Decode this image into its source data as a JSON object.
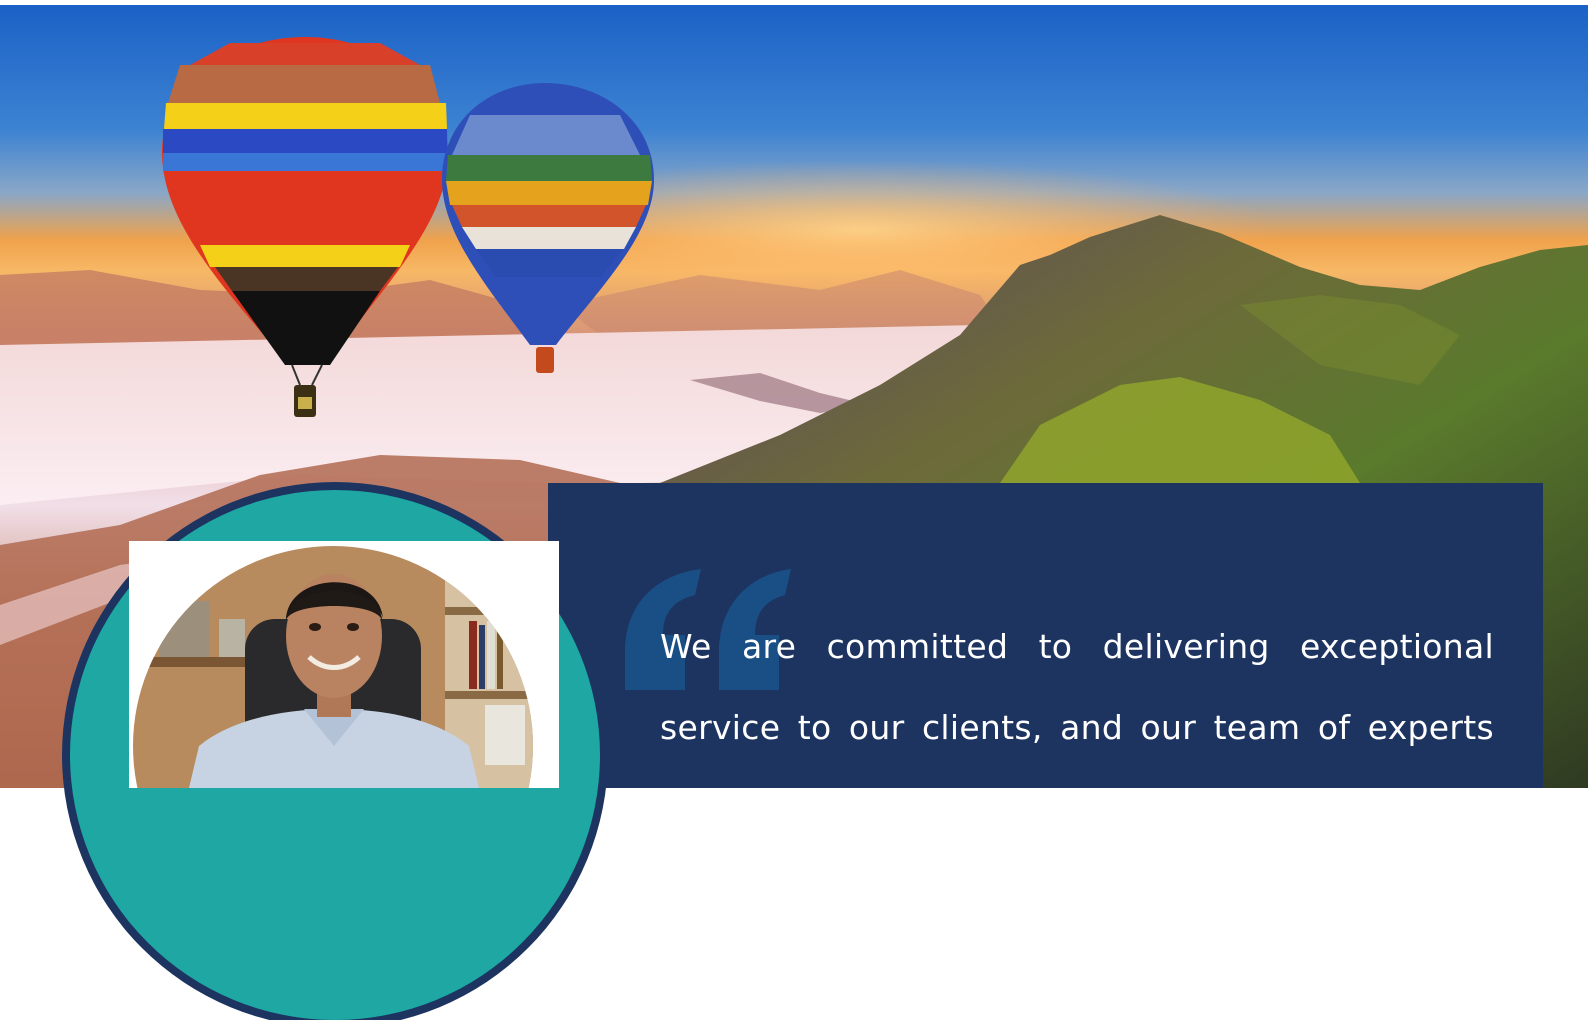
{
  "hero": {
    "image": "hot-air-balloons-over-mountains-at-sunrise"
  },
  "testimonial": {
    "quote_icon": "quote-mark-icon",
    "quote_lines": [
      "We are committed to delivering exceptional",
      "service to our clients, and our team of experts"
    ],
    "portrait": "man-in-office-portrait"
  },
  "colors": {
    "panel": "#1d3461",
    "accent_teal": "#1ea7a3",
    "quote_mark": "#1a4f86",
    "text": "#ffffff"
  }
}
